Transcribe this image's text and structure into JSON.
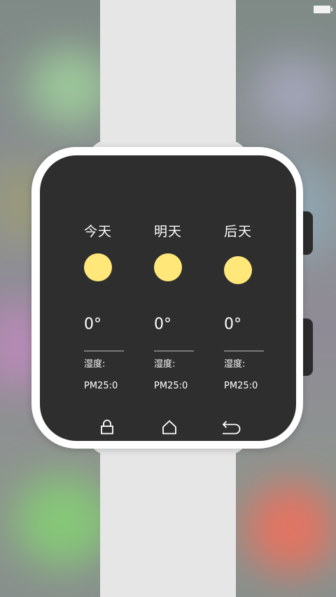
{
  "status": {
    "battery_icon": "battery-icon"
  },
  "weather": {
    "days": [
      {
        "label": "今天",
        "temp": "0°",
        "humidity": "湿度:",
        "pm": "PM25:0"
      },
      {
        "label": "明天",
        "temp": "0°",
        "humidity": "湿度:",
        "pm": "PM25:0"
      },
      {
        "label": "后天",
        "temp": "0°",
        "humidity": "湿度:",
        "pm": "PM25:0"
      }
    ]
  },
  "nav": {
    "icons": [
      "lock-icon",
      "home-icon",
      "back-icon"
    ]
  },
  "colors": {
    "screen": "#2e2e2e",
    "sun": "#ffe77a",
    "strap": "#e6e6e6",
    "case": "#ffffff"
  }
}
